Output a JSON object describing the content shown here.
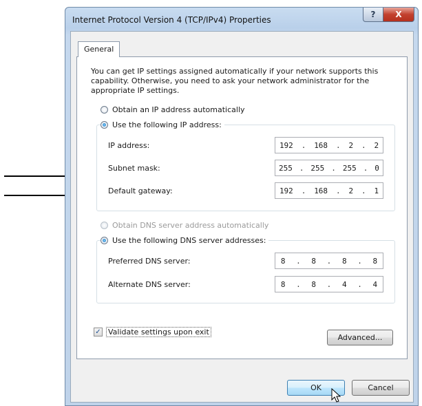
{
  "window": {
    "title": "Internet Protocol Version 4 (TCP/IPv4) Properties",
    "help_label": "?",
    "close_label": "X"
  },
  "tabs": [
    {
      "label": "General"
    }
  ],
  "description": "You can get IP settings assigned automatically if your network supports this capability. Otherwise, you need to ask your network administrator for the appropriate IP settings.",
  "ip_section": {
    "auto_label": "Obtain an IP address automatically",
    "manual_label": "Use the following IP address:",
    "fields": [
      {
        "label": "IP address:",
        "octets": [
          "192",
          "168",
          "2",
          "2"
        ]
      },
      {
        "label": "Subnet mask:",
        "octets": [
          "255",
          "255",
          "255",
          "0"
        ]
      },
      {
        "label": "Default gateway:",
        "octets": [
          "192",
          "168",
          "2",
          "1"
        ]
      }
    ]
  },
  "dns_section": {
    "auto_label": "Obtain DNS server address automatically",
    "manual_label": "Use the following DNS server addresses:",
    "fields": [
      {
        "label": "Preferred DNS server:",
        "octets": [
          "8",
          "8",
          "8",
          "8"
        ]
      },
      {
        "label": "Alternate DNS server:",
        "octets": [
          "8",
          "8",
          "4",
          "4"
        ]
      }
    ]
  },
  "validate": {
    "label": "Validate settings upon exit",
    "checked": true
  },
  "buttons": {
    "advanced": "Advanced...",
    "ok": "OK",
    "cancel": "Cancel"
  },
  "colors": {
    "close_button": "#c2412e",
    "radio_selected": "#1f6fb8",
    "default_button_border": "#3c7fb1"
  }
}
